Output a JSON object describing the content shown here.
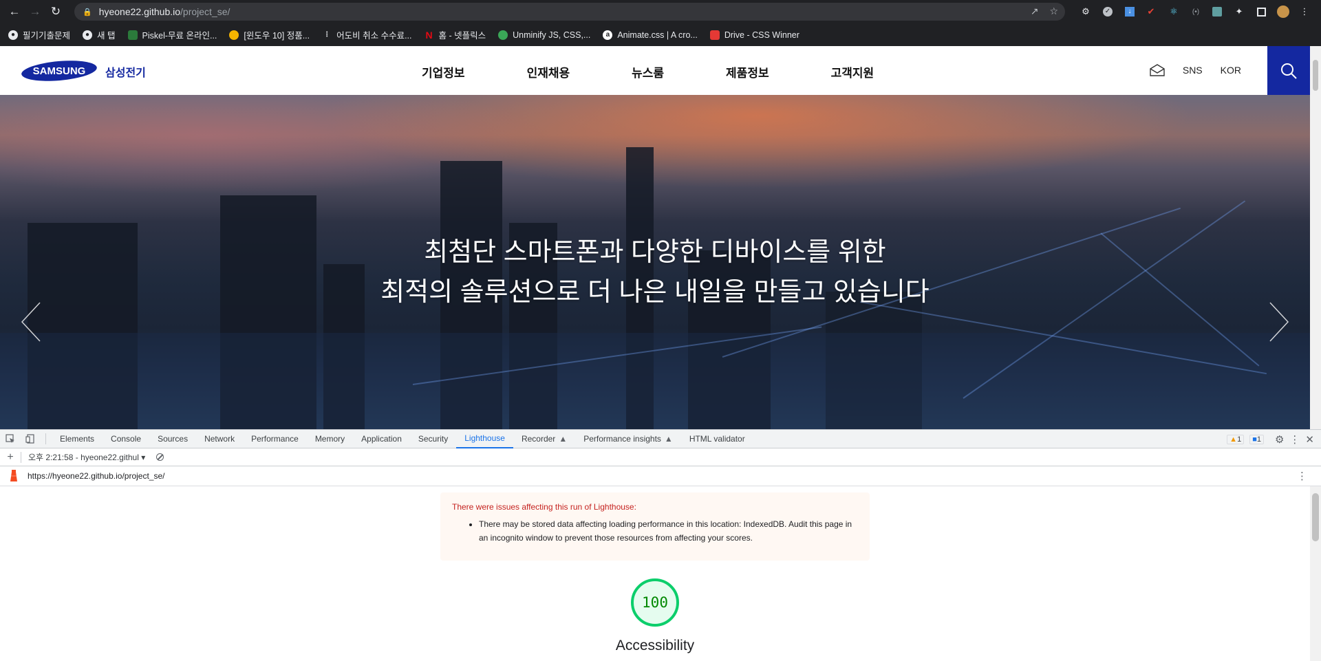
{
  "browser": {
    "url_host": "hyeone22.github.io",
    "url_path": "/project_se/",
    "bookmarks": [
      {
        "label": "필기기출문제",
        "icon": "globe-icon",
        "color": "#ffffff"
      },
      {
        "label": "새 탭",
        "icon": "globe-icon",
        "color": "#ffffff"
      },
      {
        "label": "Piskel-무료 온라인...",
        "icon": "piskel-icon",
        "color": "#2b7a3b"
      },
      {
        "label": "[윈도우 10] 정품...",
        "icon": "windows-icon",
        "color": "#f4b400"
      },
      {
        "label": "어도비 취소 수수료...",
        "icon": "dots-icon",
        "color": "#333333"
      },
      {
        "label": "홈 - 넷플릭스",
        "icon": "netflix-icon",
        "color": "#e50914"
      },
      {
        "label": "Unminify JS, CSS,...",
        "icon": "unminify-icon",
        "color": "#3aa657"
      },
      {
        "label": "Animate.css | A cro...",
        "icon": "animate-icon",
        "color": "#ffffff"
      },
      {
        "label": "Drive - CSS Winner",
        "icon": "csswinner-icon",
        "color": "#e53935"
      }
    ]
  },
  "site": {
    "logo_text": "SAMSUNG",
    "logo_ko": "삼성전기",
    "nav": [
      "기업정보",
      "인재채용",
      "뉴스룸",
      "제품정보",
      "고객지원"
    ],
    "util": {
      "sns": "SNS",
      "lang": "KOR"
    },
    "hero_line1": "최첨단 스마트폰과 다양한 디바이스를 위한",
    "hero_line2": "최적의 솔루션으로 더 나은 내일을 만들고 있습니다",
    "brand_color": "#1428a0"
  },
  "devtools": {
    "tabs": [
      "Elements",
      "Console",
      "Sources",
      "Network",
      "Performance",
      "Memory",
      "Application",
      "Security",
      "Lighthouse",
      "Recorder",
      "Performance insights",
      "HTML validator"
    ],
    "active_tab": "Lighthouse",
    "warn_count": "1",
    "msg_count": "1",
    "report_selector": "오후 2:21:58 - hyeone22.githul",
    "report_url": "https://hyeone22.github.io/project_se/",
    "warning_title": "There were issues affecting this run of Lighthouse:",
    "warning_item": "There may be stored data affecting loading performance in this location: IndexedDB. Audit this page in an incognito window to prevent those resources from affecting your scores.",
    "score": "100",
    "score_value": 100,
    "category": "Accessibility",
    "score_color": "#0cce6b"
  }
}
